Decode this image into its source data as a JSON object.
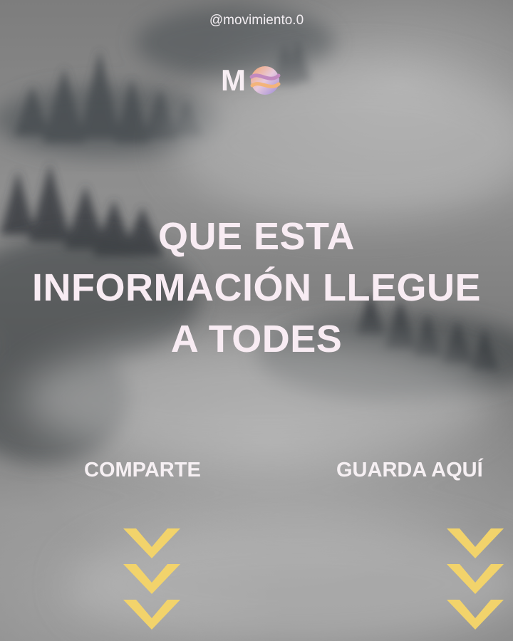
{
  "handle": "@movimiento.0",
  "logo": {
    "letter": "M",
    "icon": "planet-swirl-icon"
  },
  "headline": {
    "lines": [
      "QUE ESTA",
      "INFORMACIÓN LLEGUE",
      "A TODES"
    ]
  },
  "actions": {
    "share_label": "COMPARTE",
    "save_label": "GUARDA AQUÍ"
  },
  "colors": {
    "text": "#f8ecf3",
    "chevron": "#f2d36b",
    "background": "#8a8a8a"
  }
}
